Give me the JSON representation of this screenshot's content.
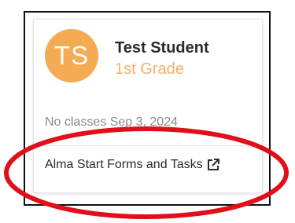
{
  "student": {
    "initials": "TS",
    "name": "Test Student",
    "grade": "1st Grade"
  },
  "schedule": {
    "status": "No classes Sep 3, 2024"
  },
  "link": {
    "label": "Alma Start Forms and Tasks",
    "icon": "external-link-icon"
  },
  "colors": {
    "avatar_bg": "#f5aa54",
    "grade_text": "#f5b06a",
    "annotation": "#e0101a"
  }
}
